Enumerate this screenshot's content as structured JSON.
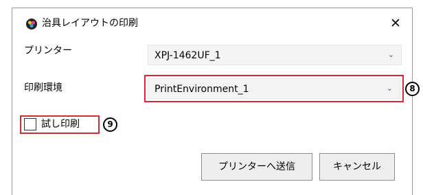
{
  "window": {
    "title": "治具レイアウトの印刷",
    "close_glyph": "✕"
  },
  "printer": {
    "label": "プリンター",
    "selected": "XPJ-1462UF_1"
  },
  "environment": {
    "label": "印刷環境",
    "selected": "PrintEnvironment_1",
    "callout": "8"
  },
  "test_print": {
    "label": "試し印刷",
    "checked": false,
    "callout": "9"
  },
  "buttons": {
    "send_label": "プリンターへ送信",
    "cancel_label": "キャンセル"
  },
  "icons": {
    "app": "printer-color-icon",
    "close": "close-icon",
    "dropdown": "chevron-down-icon"
  },
  "colors": {
    "highlight": "#d6283a",
    "field_bg": "#f4f4f4",
    "button_bg": "#eeeeee"
  }
}
